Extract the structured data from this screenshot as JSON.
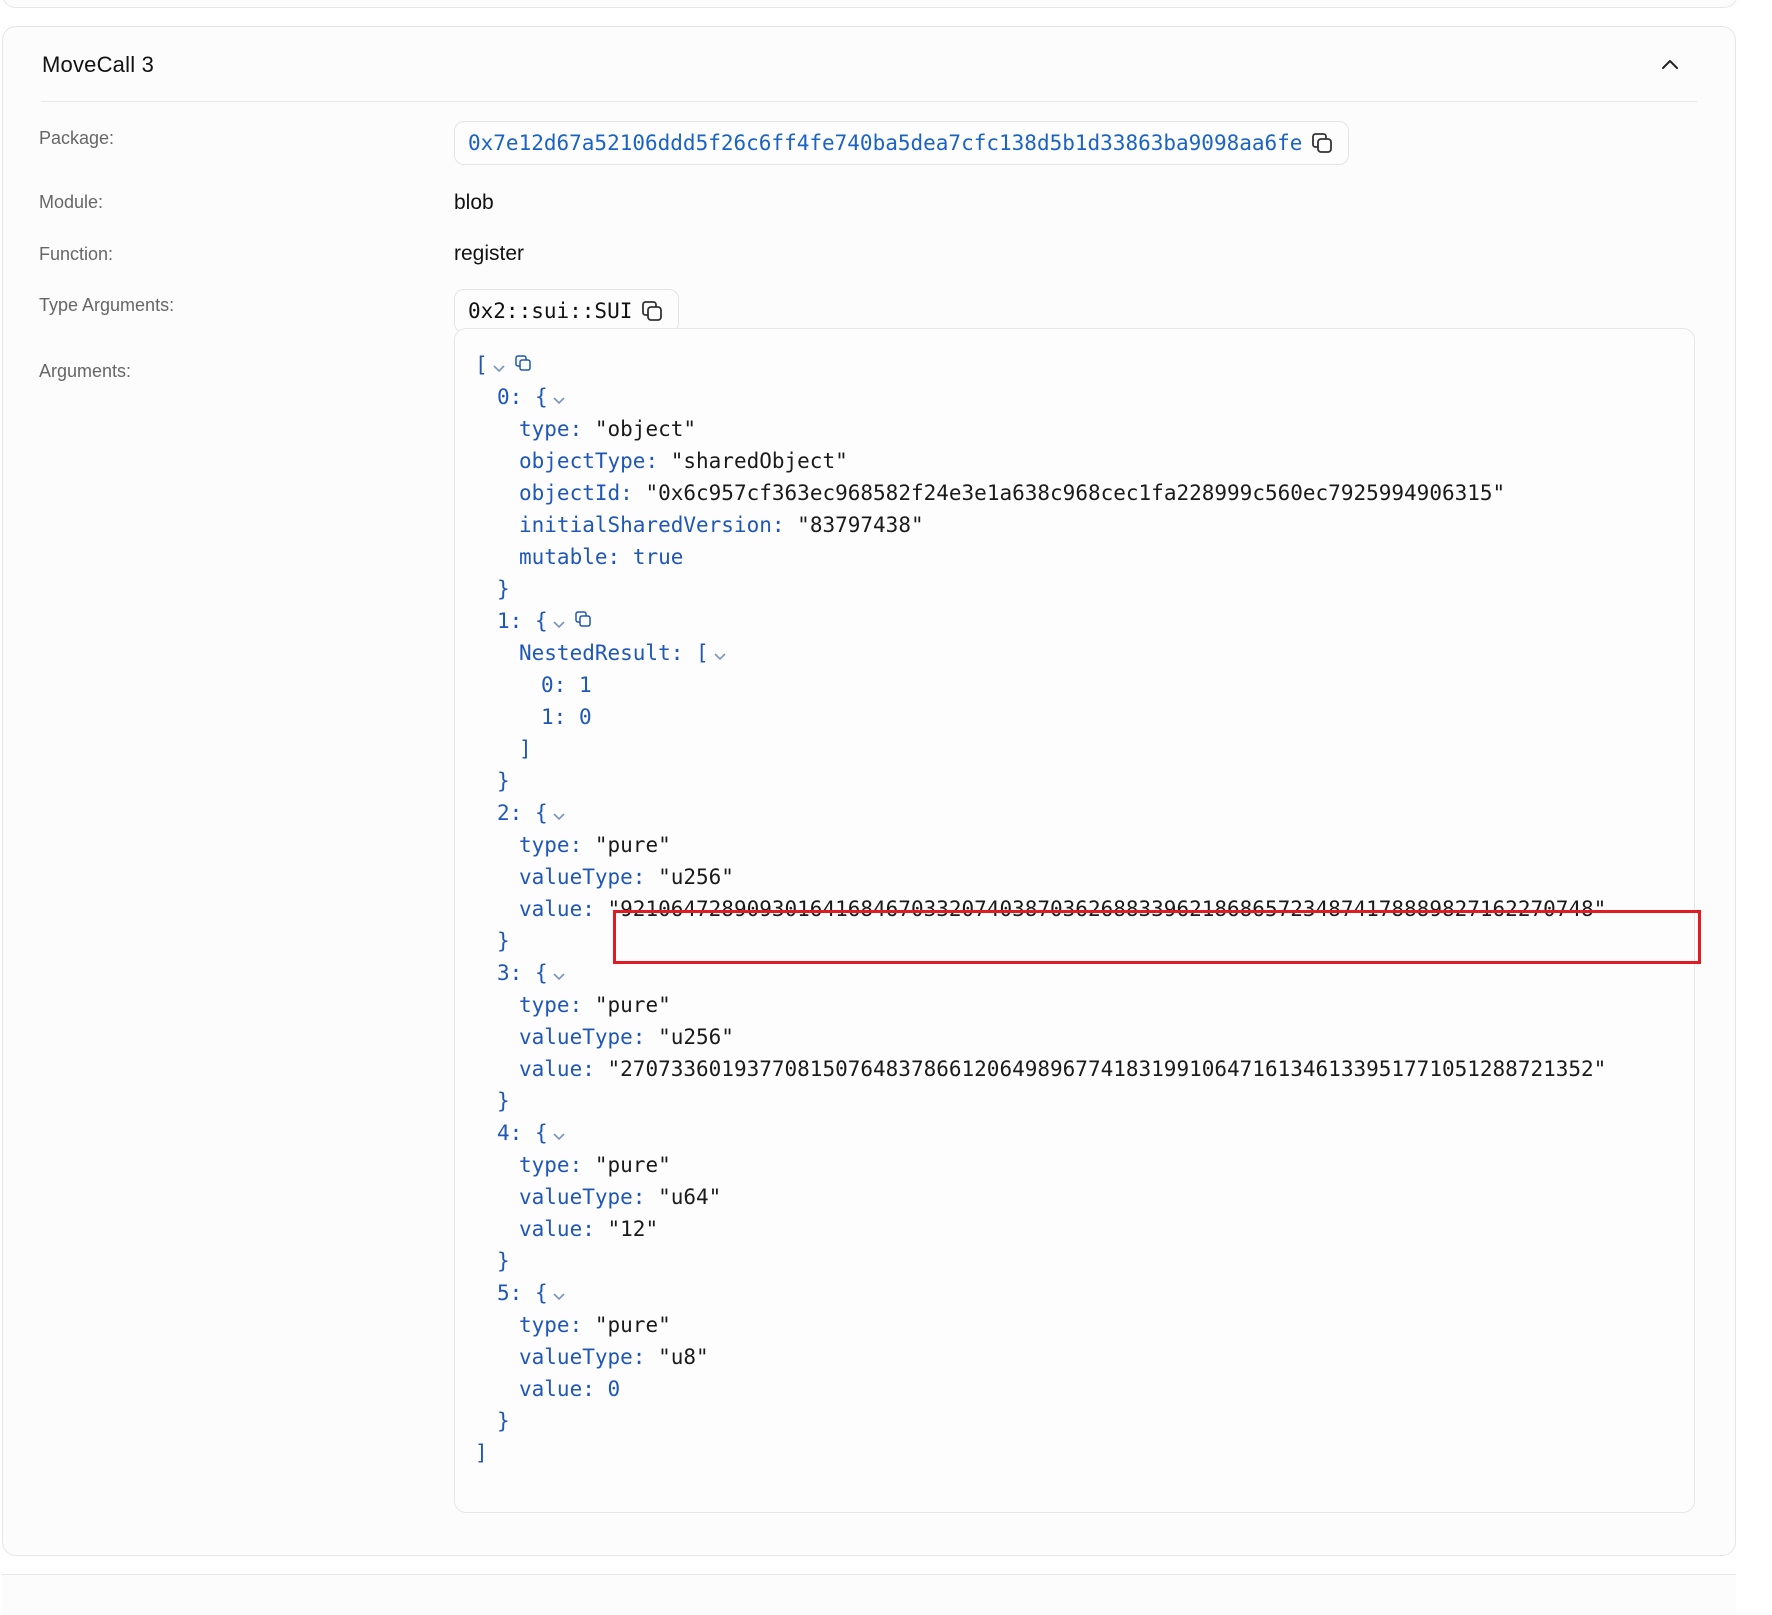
{
  "card": {
    "title": "MoveCall 3"
  },
  "fields": {
    "package_label": "Package:",
    "package_value": "0x7e12d67a52106ddd5f26c6ff4fe740ba5dea7cfc138d5b1d33863ba9098aa6fe",
    "module_label": "Module:",
    "module_value": "blob",
    "function_label": "Function:",
    "function_value": "register",
    "type_args_label": "Type Arguments:",
    "type_args_value": "0x2::sui::SUI",
    "arguments_label": "Arguments:"
  },
  "arguments": [
    {
      "index": "0",
      "entries": [
        {
          "key": "type",
          "value": "\"object\""
        },
        {
          "key": "objectType",
          "value": "\"sharedObject\""
        },
        {
          "key": "objectId",
          "value": "\"0x6c957cf363ec968582f24e3e1a638c968cec1fa228999c560ec7925994906315\""
        },
        {
          "key": "initialSharedVersion",
          "value": "\"83797438\""
        },
        {
          "key": "mutable",
          "value": "true"
        }
      ]
    },
    {
      "index": "1",
      "nested_key": "NestedResult",
      "nested_items": [
        {
          "key": "0",
          "value": "1"
        },
        {
          "key": "1",
          "value": "0"
        }
      ]
    },
    {
      "index": "2",
      "entries": [
        {
          "key": "type",
          "value": "\"pure\""
        },
        {
          "key": "valueType",
          "value": "\"u256\""
        },
        {
          "key": "value",
          "value": "\"92106472890930164168467033207403870362688339621868657234874178889827162270748\""
        }
      ]
    },
    {
      "index": "3",
      "entries": [
        {
          "key": "type",
          "value": "\"pure\""
        },
        {
          "key": "valueType",
          "value": "\"u256\""
        },
        {
          "key": "value",
          "value": "\"27073360193770815076483786612064989677418319910647161346133951771051288721352\""
        }
      ]
    },
    {
      "index": "4",
      "entries": [
        {
          "key": "type",
          "value": "\"pure\""
        },
        {
          "key": "valueType",
          "value": "\"u64\""
        },
        {
          "key": "value",
          "value": "\"12\""
        }
      ]
    },
    {
      "index": "5",
      "entries": [
        {
          "key": "type",
          "value": "\"pure\""
        },
        {
          "key": "valueType",
          "value": "\"u8\""
        },
        {
          "key": "value",
          "value": "0"
        }
      ]
    }
  ],
  "colors": {
    "key": "#1e57b8",
    "string": "#1a1a1a",
    "highlight_box": "#e01b24"
  }
}
